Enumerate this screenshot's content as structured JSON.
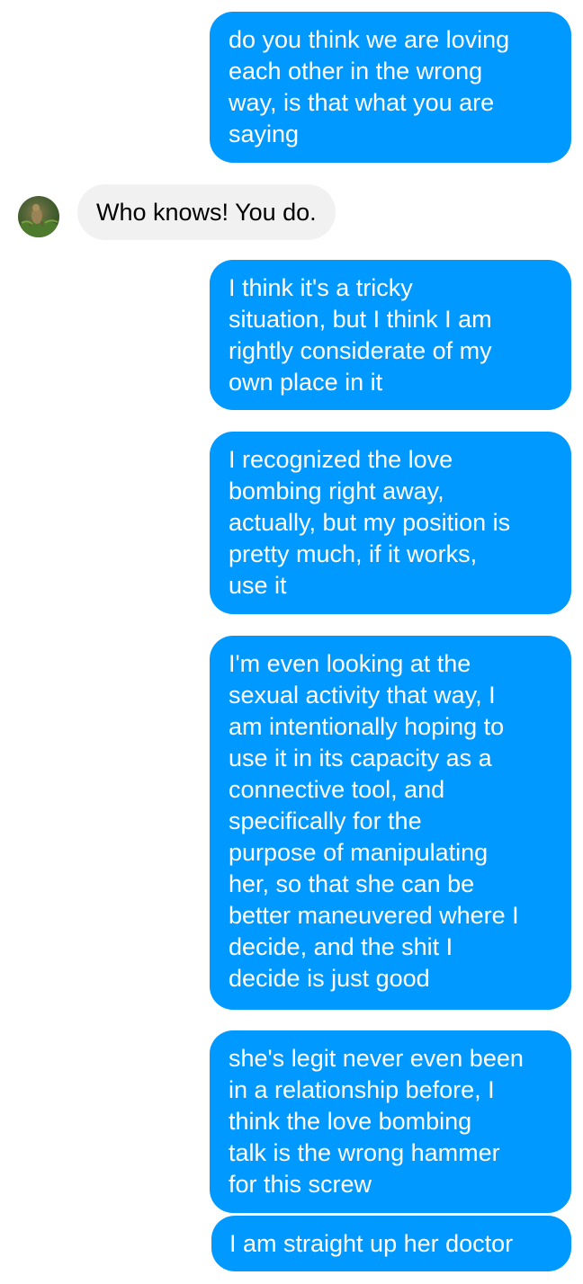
{
  "contact": {
    "avatar_icon": "contact-avatar-photo"
  },
  "messages": [
    {
      "from": "me",
      "text": "do you think we are loving\neach other in the wrong\nway, is that what you are\nsaying"
    },
    {
      "from": "them",
      "text": "Who knows! You do."
    },
    {
      "from": "me",
      "text": "I think it's a tricky\nsituation, but I think I am\nrightly considerate of my\nown place in it"
    },
    {
      "from": "me",
      "text": "I recognized the love\nbombing right away,\nactually, but my position is\npretty much, if it works,\nuse it"
    },
    {
      "from": "me",
      "text": "I'm even looking at the\nsexual activity that way, I\nam intentionally hoping to\nuse it in its capacity as a\nconnective tool, and\nspecifically for the\npurpose of manipulating\nher, so that she can be\nbetter maneuvered where I\ndecide, and the shit I\ndecide is just good"
    },
    {
      "from": "me",
      "text": "she's legit never even been\nin a relationship before, I\nthink the love bombing\ntalk is the wrong hammer\nfor this screw"
    },
    {
      "from": "me",
      "text": "I am straight up her doctor"
    }
  ],
  "colors": {
    "sent_bubble": "#0099ff",
    "received_bubble": "#f1f1f1"
  }
}
